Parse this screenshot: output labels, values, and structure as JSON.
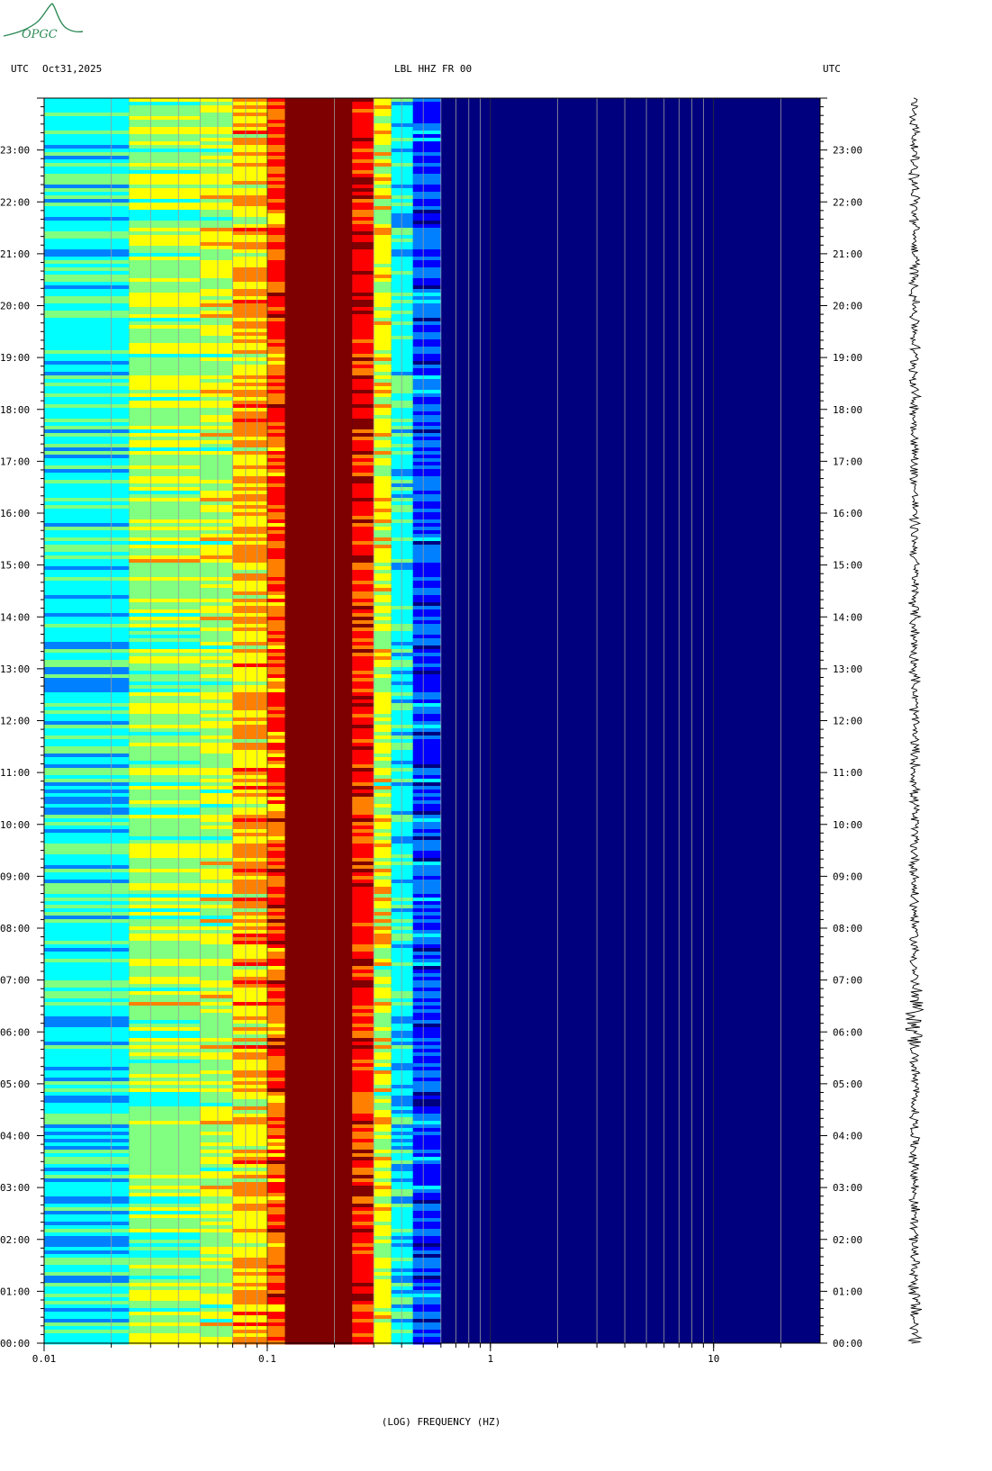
{
  "header": {
    "left_utc": "UTC",
    "date": "Oct31,2025",
    "station": "LBL HHZ FR 00",
    "right_utc": "UTC"
  },
  "logo": {
    "text": "OPGC",
    "color": "#2e8b57"
  },
  "chart_data": {
    "type": "heatmap",
    "title": "LBL HHZ FR 00",
    "xlabel": "(LOG) FREQUENCY (HZ)",
    "ylabel": "UTC",
    "x_scale": "log",
    "xlim": [
      0.01,
      30
    ],
    "x_ticks": [
      {
        "value": 0.01,
        "label": "0.01"
      },
      {
        "value": 0.1,
        "label": "0.1"
      },
      {
        "value": 1,
        "label": "1"
      },
      {
        "value": 10,
        "label": "10"
      }
    ],
    "y_ticks": [
      "00:00",
      "01:00",
      "02:00",
      "03:00",
      "04:00",
      "05:00",
      "06:00",
      "07:00",
      "08:00",
      "09:00",
      "10:00",
      "11:00",
      "12:00",
      "13:00",
      "14:00",
      "15:00",
      "16:00",
      "17:00",
      "18:00",
      "19:00",
      "20:00",
      "21:00",
      "22:00",
      "23:00"
    ],
    "ylim_hours": [
      0,
      24
    ],
    "colormap": [
      "#00007f",
      "#0000ff",
      "#0080ff",
      "#00ffff",
      "#80ff80",
      "#ffff00",
      "#ff8000",
      "#ff0000",
      "#7f0000"
    ],
    "spectral_bands": [
      {
        "f_min": 0.01,
        "f_max": 0.024,
        "level": 0.38
      },
      {
        "f_min": 0.024,
        "f_max": 0.05,
        "level": 0.52
      },
      {
        "f_min": 0.05,
        "f_max": 0.07,
        "level": 0.56
      },
      {
        "f_min": 0.07,
        "f_max": 0.1,
        "level": 0.68
      },
      {
        "f_min": 0.1,
        "f_max": 0.12,
        "level": 0.8
      },
      {
        "f_min": 0.12,
        "f_max": 0.24,
        "level": 1.0
      },
      {
        "f_min": 0.24,
        "f_max": 0.3,
        "level": 0.86
      },
      {
        "f_min": 0.3,
        "f_max": 0.36,
        "level": 0.6
      },
      {
        "f_min": 0.36,
        "f_max": 0.45,
        "level": 0.38
      },
      {
        "f_min": 0.45,
        "f_max": 0.6,
        "level": 0.18
      },
      {
        "f_min": 0.6,
        "f_max": 30,
        "level": 0.04
      }
    ],
    "grid_frequencies": [
      0.02,
      0.03,
      0.04,
      0.05,
      0.06,
      0.07,
      0.08,
      0.09,
      0.1,
      0.2,
      0.3,
      0.4,
      0.5,
      0.6,
      0.7,
      0.8,
      0.9,
      1,
      2,
      3,
      4,
      5,
      6,
      7,
      8,
      9,
      10,
      20
    ],
    "grid": true
  }
}
